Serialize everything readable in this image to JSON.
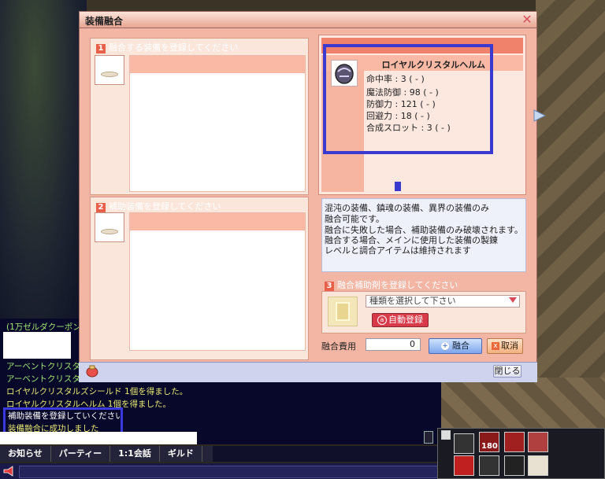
{
  "dialog": {
    "title": "装備融合",
    "close_glyph": "✕",
    "close_button_label": "閉じる"
  },
  "main_section": {
    "number": "1",
    "header": "融合する装備を登録してください"
  },
  "sub_section": {
    "number": "2",
    "header": "補助装備を登録してください"
  },
  "item": {
    "name": "ロイヤルクリスタルヘルム",
    "stats": [
      "命中率 : 3 ( - )",
      "魔法防御 : 98 ( - )",
      "防御力 : 121 ( - )",
      "回避力 : 18 ( - )",
      "合成スロット : 3 ( - )"
    ]
  },
  "info": {
    "lines": [
      "混沌の装備、鎮魂の装備、異界の装備のみ",
      "融合可能です。",
      "融合に失敗した場合、補助装備のみ破壊されます。",
      "融合する場合、メインに使用した装備の製錬",
      "レベルと調合アイテムは維持されます"
    ]
  },
  "support": {
    "number": "3",
    "header": "融合補助剤を登録してください",
    "select_value": "種類を選択して下さい",
    "auto_button": "自動登録"
  },
  "fee": {
    "label": "融合費用",
    "value": "0"
  },
  "buttons": {
    "fuse": "融合",
    "cancel": "取消"
  },
  "chat": {
    "lines": [
      {
        "text": "(1万ゼルダクーポン",
        "color": "#9fe870"
      },
      {
        "text": "アーベントクリスタル",
        "color": "#9fe870"
      },
      {
        "text": "アーベントクリスタル",
        "color": "#9fe870"
      },
      {
        "text": "ロイヤルクリスタルズシールド 1個を得ました。",
        "color": "#e8e870"
      },
      {
        "text": "ロイヤルクリスタルヘルム 1個を得ました。",
        "color": "#e8e870"
      },
      {
        "text": "補助装備を登録していください",
        "color": "#ffffff"
      },
      {
        "text": "装備融合に成功しました",
        "color": "#e8e870"
      }
    ],
    "tabs": [
      "お知らせ",
      "パーティー",
      "1:1会話",
      "ギルド"
    ]
  },
  "skillbar": {
    "slot_count_text": "180"
  },
  "colors": {
    "highlight": "#3a3ad0",
    "dialog_bg": "#f3b6a4",
    "chat_bg": "#08082a"
  }
}
